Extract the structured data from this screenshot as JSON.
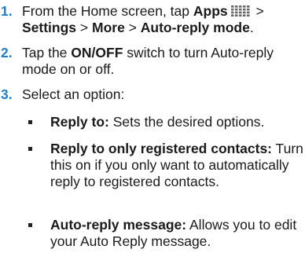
{
  "steps": [
    {
      "number": "1.",
      "parts": {
        "a": "From the Home screen, tap ",
        "apps": "Apps",
        "gt1": " > ",
        "settings": "Settings",
        "gt2": " > ",
        "more": "More",
        "gt3": " > ",
        "autoreply": "Auto-reply mode",
        "end": "."
      },
      "apps_icon": "apps-grid-icon"
    },
    {
      "number": "2.",
      "parts": {
        "a": "Tap the ",
        "onoff": "ON/OFF",
        "b": " switch to turn Auto-reply mode on or off."
      }
    },
    {
      "number": "3.",
      "parts": {
        "a": "Select an option:"
      }
    }
  ],
  "options": [
    {
      "term": "Reply to:",
      "desc": " Sets the desired options."
    },
    {
      "term": "Reply to only registered contacts:",
      "desc": " Turn this on if you only want to automatically reply to registered contacts."
    },
    {
      "term": "Auto-reply message:",
      "desc": " Allows you to edit your Auto Reply message."
    }
  ],
  "colors": {
    "step_number": "#1a7fd0",
    "text": "#1a1a1a",
    "icon": "#666666"
  }
}
